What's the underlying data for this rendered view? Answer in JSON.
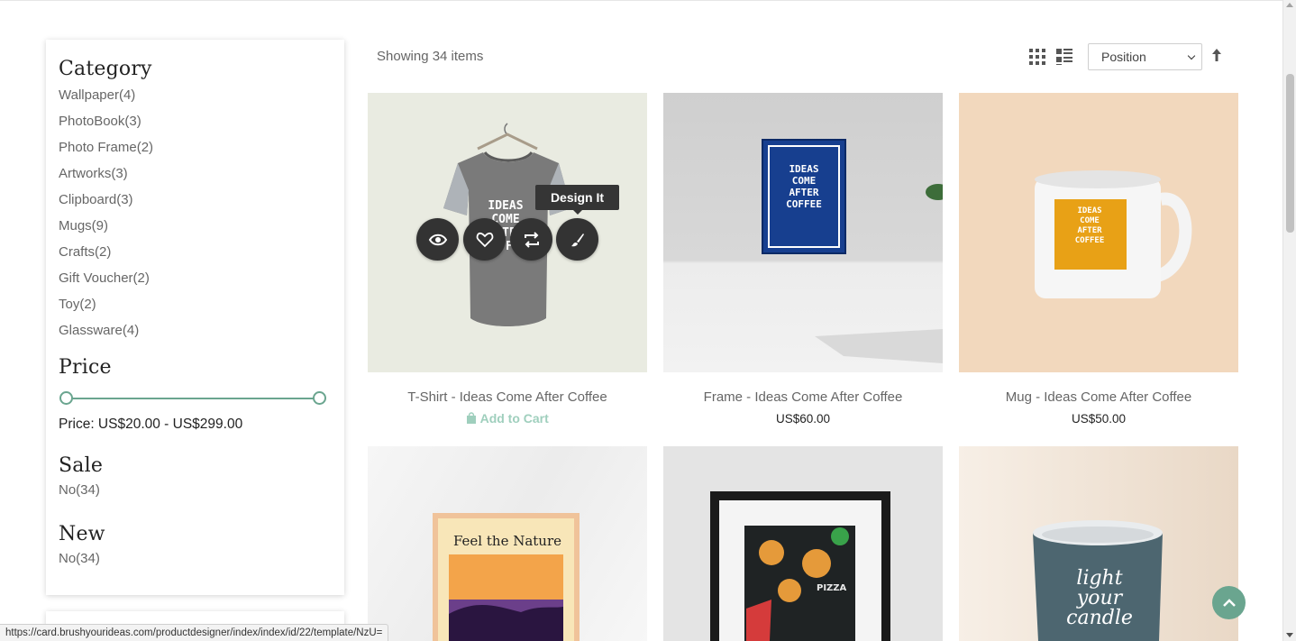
{
  "sidebar": {
    "category_title": "Category",
    "categories": [
      {
        "label": "Wallpaper(4)"
      },
      {
        "label": "PhotoBook(3)"
      },
      {
        "label": "Photo Frame(2)"
      },
      {
        "label": "Artworks(3)"
      },
      {
        "label": "Clipboard(3)"
      },
      {
        "label": "Mugs(9)"
      },
      {
        "label": "Crafts(2)"
      },
      {
        "label": "Gift Voucher(2)"
      },
      {
        "label": "Toy(2)"
      },
      {
        "label": "Glassware(4)"
      }
    ],
    "price_title": "Price",
    "price_range_text": "Price: US$20.00 - US$299.00",
    "sale_title": "Sale",
    "sale_option": "No(34)",
    "new_title": "New",
    "new_option": "No(34)"
  },
  "toolbar": {
    "count_text": "Showing 34 items",
    "sort_value": "Position"
  },
  "products": [
    {
      "name": "T-Shirt - Ideas Come After Coffee",
      "cart_label": "Add to Cart",
      "tooltip": "Design It"
    },
    {
      "name": "Frame - Ideas Come After Coffee",
      "price": "US$60.00"
    },
    {
      "name": "Mug - Ideas Come After Coffee",
      "price": "US$50.00"
    },
    {
      "poster_text": "Feel the Nature"
    },
    {
      "poster_text": "PIZZA"
    },
    {
      "poster_text": "light your candle"
    }
  ],
  "artwork_text": "IDEAS COME AFTER COFFEE",
  "status_bar_url": "https://card.brushyourideas.com/productdesigner/index/index/id/22/template/NzU=",
  "colors": {
    "accent": "#6aa58f",
    "cart_text": "#9fcfbd",
    "dark_button": "#333333"
  }
}
